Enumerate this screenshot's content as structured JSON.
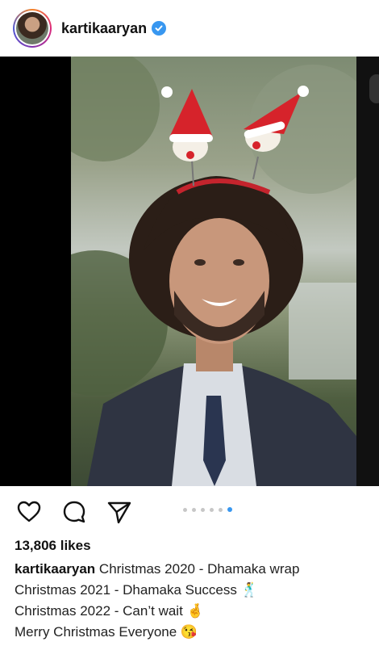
{
  "header": {
    "username": "kartikaaryan",
    "verified_icon": "verified-badge-icon"
  },
  "post": {
    "carousel": {
      "total": 6,
      "active_index": 5
    },
    "likes": "13,806 likes",
    "caption": {
      "username": "kartikaaryan",
      "lines": [
        "Christmas 2020 - Dhamaka wrap",
        "Christmas 2021 - Dhamaka Success 🕺",
        "Christmas 2022 - Can’t wait 🤞",
        "Merry Christmas Everyone 😘"
      ]
    }
  },
  "actions": {
    "like_icon": "heart-icon",
    "comment_icon": "comment-icon",
    "share_icon": "send-icon"
  },
  "colors": {
    "accent": "#3897f0",
    "text": "#262626"
  }
}
